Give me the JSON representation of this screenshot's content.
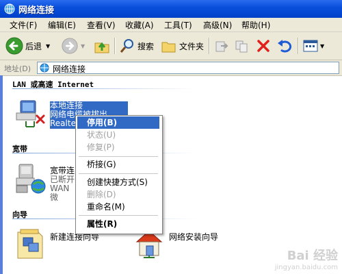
{
  "window": {
    "title": "网络连接"
  },
  "menu": [
    "文件(F)",
    "编辑(E)",
    "查看(V)",
    "收藏(A)",
    "工具(T)",
    "高级(N)",
    "帮助(H)"
  ],
  "toolbar": {
    "back_label": "后退",
    "search_label": "搜索",
    "folders_label": "文件夹"
  },
  "address": {
    "label": "地址(D)",
    "value": "网络连接"
  },
  "groups": {
    "lan": "LAN 或高速 Internet",
    "broadband": "宽带",
    "wizard": "向导"
  },
  "items": {
    "local": {
      "name": "本地连接",
      "status": "网络电缆被拔出",
      "device": "Realte"
    },
    "broadband": {
      "name": "宽带连",
      "status": "已断开",
      "device": "WAN 微"
    },
    "new_wizard": {
      "name": "新建连接向导"
    },
    "home_wizard": {
      "name": "网络安装向导"
    }
  },
  "context_menu": {
    "disable": "停用(B)",
    "status": "状态(U)",
    "repair": "修复(P)",
    "bridge": "桥接(G)",
    "shortcut": "创建快捷方式(S)",
    "delete": "删除(D)",
    "rename": "重命名(M)",
    "properties": "属性(R)"
  },
  "watermark": {
    "brand": "Bai 经验",
    "url": "jingyan.baidu.com"
  }
}
